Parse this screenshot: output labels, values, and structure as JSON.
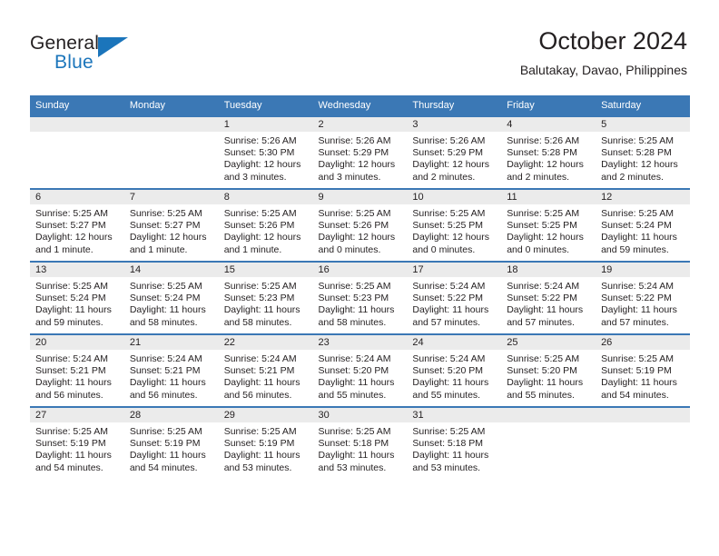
{
  "brand": {
    "name_top": "General",
    "name_bottom": "Blue",
    "accent_color": "#1b75bb",
    "triangle_icon": "brand-triangle-icon"
  },
  "header": {
    "title": "October 2024",
    "subtitle": "Balutakay, Davao, Philippines"
  },
  "theme": {
    "header_blue": "#3b78b5",
    "daynum_band": "#ebebeb",
    "text": "#231f20"
  },
  "weekdays": [
    "Sunday",
    "Monday",
    "Tuesday",
    "Wednesday",
    "Thursday",
    "Friday",
    "Saturday"
  ],
  "weeks": [
    [
      {
        "day": "",
        "empty": true
      },
      {
        "day": "",
        "empty": true
      },
      {
        "day": "1",
        "sunrise": "Sunrise: 5:26 AM",
        "sunset": "Sunset: 5:30 PM",
        "daylight1": "Daylight: 12 hours",
        "daylight2": "and 3 minutes."
      },
      {
        "day": "2",
        "sunrise": "Sunrise: 5:26 AM",
        "sunset": "Sunset: 5:29 PM",
        "daylight1": "Daylight: 12 hours",
        "daylight2": "and 3 minutes."
      },
      {
        "day": "3",
        "sunrise": "Sunrise: 5:26 AM",
        "sunset": "Sunset: 5:29 PM",
        "daylight1": "Daylight: 12 hours",
        "daylight2": "and 2 minutes."
      },
      {
        "day": "4",
        "sunrise": "Sunrise: 5:26 AM",
        "sunset": "Sunset: 5:28 PM",
        "daylight1": "Daylight: 12 hours",
        "daylight2": "and 2 minutes."
      },
      {
        "day": "5",
        "sunrise": "Sunrise: 5:25 AM",
        "sunset": "Sunset: 5:28 PM",
        "daylight1": "Daylight: 12 hours",
        "daylight2": "and 2 minutes."
      }
    ],
    [
      {
        "day": "6",
        "sunrise": "Sunrise: 5:25 AM",
        "sunset": "Sunset: 5:27 PM",
        "daylight1": "Daylight: 12 hours",
        "daylight2": "and 1 minute."
      },
      {
        "day": "7",
        "sunrise": "Sunrise: 5:25 AM",
        "sunset": "Sunset: 5:27 PM",
        "daylight1": "Daylight: 12 hours",
        "daylight2": "and 1 minute."
      },
      {
        "day": "8",
        "sunrise": "Sunrise: 5:25 AM",
        "sunset": "Sunset: 5:26 PM",
        "daylight1": "Daylight: 12 hours",
        "daylight2": "and 1 minute."
      },
      {
        "day": "9",
        "sunrise": "Sunrise: 5:25 AM",
        "sunset": "Sunset: 5:26 PM",
        "daylight1": "Daylight: 12 hours",
        "daylight2": "and 0 minutes."
      },
      {
        "day": "10",
        "sunrise": "Sunrise: 5:25 AM",
        "sunset": "Sunset: 5:25 PM",
        "daylight1": "Daylight: 12 hours",
        "daylight2": "and 0 minutes."
      },
      {
        "day": "11",
        "sunrise": "Sunrise: 5:25 AM",
        "sunset": "Sunset: 5:25 PM",
        "daylight1": "Daylight: 12 hours",
        "daylight2": "and 0 minutes."
      },
      {
        "day": "12",
        "sunrise": "Sunrise: 5:25 AM",
        "sunset": "Sunset: 5:24 PM",
        "daylight1": "Daylight: 11 hours",
        "daylight2": "and 59 minutes."
      }
    ],
    [
      {
        "day": "13",
        "sunrise": "Sunrise: 5:25 AM",
        "sunset": "Sunset: 5:24 PM",
        "daylight1": "Daylight: 11 hours",
        "daylight2": "and 59 minutes."
      },
      {
        "day": "14",
        "sunrise": "Sunrise: 5:25 AM",
        "sunset": "Sunset: 5:24 PM",
        "daylight1": "Daylight: 11 hours",
        "daylight2": "and 58 minutes."
      },
      {
        "day": "15",
        "sunrise": "Sunrise: 5:25 AM",
        "sunset": "Sunset: 5:23 PM",
        "daylight1": "Daylight: 11 hours",
        "daylight2": "and 58 minutes."
      },
      {
        "day": "16",
        "sunrise": "Sunrise: 5:25 AM",
        "sunset": "Sunset: 5:23 PM",
        "daylight1": "Daylight: 11 hours",
        "daylight2": "and 58 minutes."
      },
      {
        "day": "17",
        "sunrise": "Sunrise: 5:24 AM",
        "sunset": "Sunset: 5:22 PM",
        "daylight1": "Daylight: 11 hours",
        "daylight2": "and 57 minutes."
      },
      {
        "day": "18",
        "sunrise": "Sunrise: 5:24 AM",
        "sunset": "Sunset: 5:22 PM",
        "daylight1": "Daylight: 11 hours",
        "daylight2": "and 57 minutes."
      },
      {
        "day": "19",
        "sunrise": "Sunrise: 5:24 AM",
        "sunset": "Sunset: 5:22 PM",
        "daylight1": "Daylight: 11 hours",
        "daylight2": "and 57 minutes."
      }
    ],
    [
      {
        "day": "20",
        "sunrise": "Sunrise: 5:24 AM",
        "sunset": "Sunset: 5:21 PM",
        "daylight1": "Daylight: 11 hours",
        "daylight2": "and 56 minutes."
      },
      {
        "day": "21",
        "sunrise": "Sunrise: 5:24 AM",
        "sunset": "Sunset: 5:21 PM",
        "daylight1": "Daylight: 11 hours",
        "daylight2": "and 56 minutes."
      },
      {
        "day": "22",
        "sunrise": "Sunrise: 5:24 AM",
        "sunset": "Sunset: 5:21 PM",
        "daylight1": "Daylight: 11 hours",
        "daylight2": "and 56 minutes."
      },
      {
        "day": "23",
        "sunrise": "Sunrise: 5:24 AM",
        "sunset": "Sunset: 5:20 PM",
        "daylight1": "Daylight: 11 hours",
        "daylight2": "and 55 minutes."
      },
      {
        "day": "24",
        "sunrise": "Sunrise: 5:24 AM",
        "sunset": "Sunset: 5:20 PM",
        "daylight1": "Daylight: 11 hours",
        "daylight2": "and 55 minutes."
      },
      {
        "day": "25",
        "sunrise": "Sunrise: 5:25 AM",
        "sunset": "Sunset: 5:20 PM",
        "daylight1": "Daylight: 11 hours",
        "daylight2": "and 55 minutes."
      },
      {
        "day": "26",
        "sunrise": "Sunrise: 5:25 AM",
        "sunset": "Sunset: 5:19 PM",
        "daylight1": "Daylight: 11 hours",
        "daylight2": "and 54 minutes."
      }
    ],
    [
      {
        "day": "27",
        "sunrise": "Sunrise: 5:25 AM",
        "sunset": "Sunset: 5:19 PM",
        "daylight1": "Daylight: 11 hours",
        "daylight2": "and 54 minutes."
      },
      {
        "day": "28",
        "sunrise": "Sunrise: 5:25 AM",
        "sunset": "Sunset: 5:19 PM",
        "daylight1": "Daylight: 11 hours",
        "daylight2": "and 54 minutes."
      },
      {
        "day": "29",
        "sunrise": "Sunrise: 5:25 AM",
        "sunset": "Sunset: 5:19 PM",
        "daylight1": "Daylight: 11 hours",
        "daylight2": "and 53 minutes."
      },
      {
        "day": "30",
        "sunrise": "Sunrise: 5:25 AM",
        "sunset": "Sunset: 5:18 PM",
        "daylight1": "Daylight: 11 hours",
        "daylight2": "and 53 minutes."
      },
      {
        "day": "31",
        "sunrise": "Sunrise: 5:25 AM",
        "sunset": "Sunset: 5:18 PM",
        "daylight1": "Daylight: 11 hours",
        "daylight2": "and 53 minutes."
      },
      {
        "day": "",
        "empty": true
      },
      {
        "day": "",
        "empty": true
      }
    ]
  ]
}
